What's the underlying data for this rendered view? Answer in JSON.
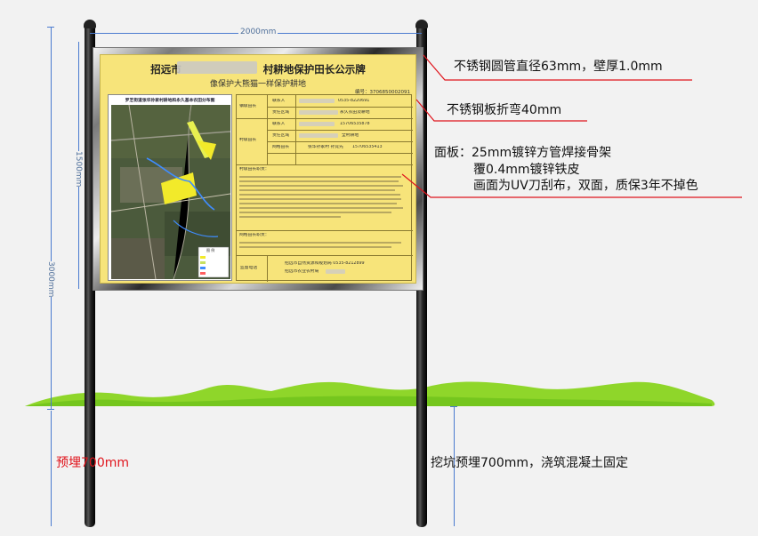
{
  "sign": {
    "title_prefix": "招远市",
    "title_suffix": "村耕地保护田长公示牌",
    "subtitle": "像保护大熊猫一样保护耕地",
    "code": "编号：3706850002091",
    "map_title": "罗芝街道张华孙家村耕地和永久基本农田分布图",
    "legend_title": "图 例",
    "rows": {
      "village_chief": "镇级田长",
      "village_field_chief": "村级田长",
      "contact": "联系人",
      "contact2": "联系人",
      "area": "责任区域",
      "area2": "责任区域",
      "grid": "网格田长",
      "duty": "村级田长职责：",
      "grid_duty": "网格田长职责：",
      "supervise": "监督电话",
      "phone1": "0535-8220691",
      "area1_value": "永久农田及耕地",
      "phone2": "15706535878",
      "area2_value": "全村耕地",
      "grid_value": "张华孙家村 孙竞先",
      "phone3": "15706535413",
      "sup1": "招远市自然资源和规划局 0535-8212899",
      "sup2": "招远市农业农村局"
    }
  },
  "dimensions": {
    "width": "2000mm",
    "panel_height": "1500mm",
    "total_height": "3000mm"
  },
  "callouts": {
    "pipe": "不锈钢圆管直径63mm，壁厚1.0mm",
    "bend": "不锈钢板折弯40mm",
    "panel_line1": "面板：25mm镀锌方管焊接骨架",
    "panel_line2": "覆0.4mm镀锌铁皮",
    "panel_line3": "画面为UV刀刮布，双面，质保3年不掉色",
    "buried_left": "预埋700mm",
    "buried_right": "挖坑预埋700mm，浇筑混凝土固定"
  },
  "colors": {
    "panel": "#f7e47a",
    "dimension": "#4a7bd0",
    "callout_line": "#e0141c",
    "grass": "#7ed321"
  }
}
